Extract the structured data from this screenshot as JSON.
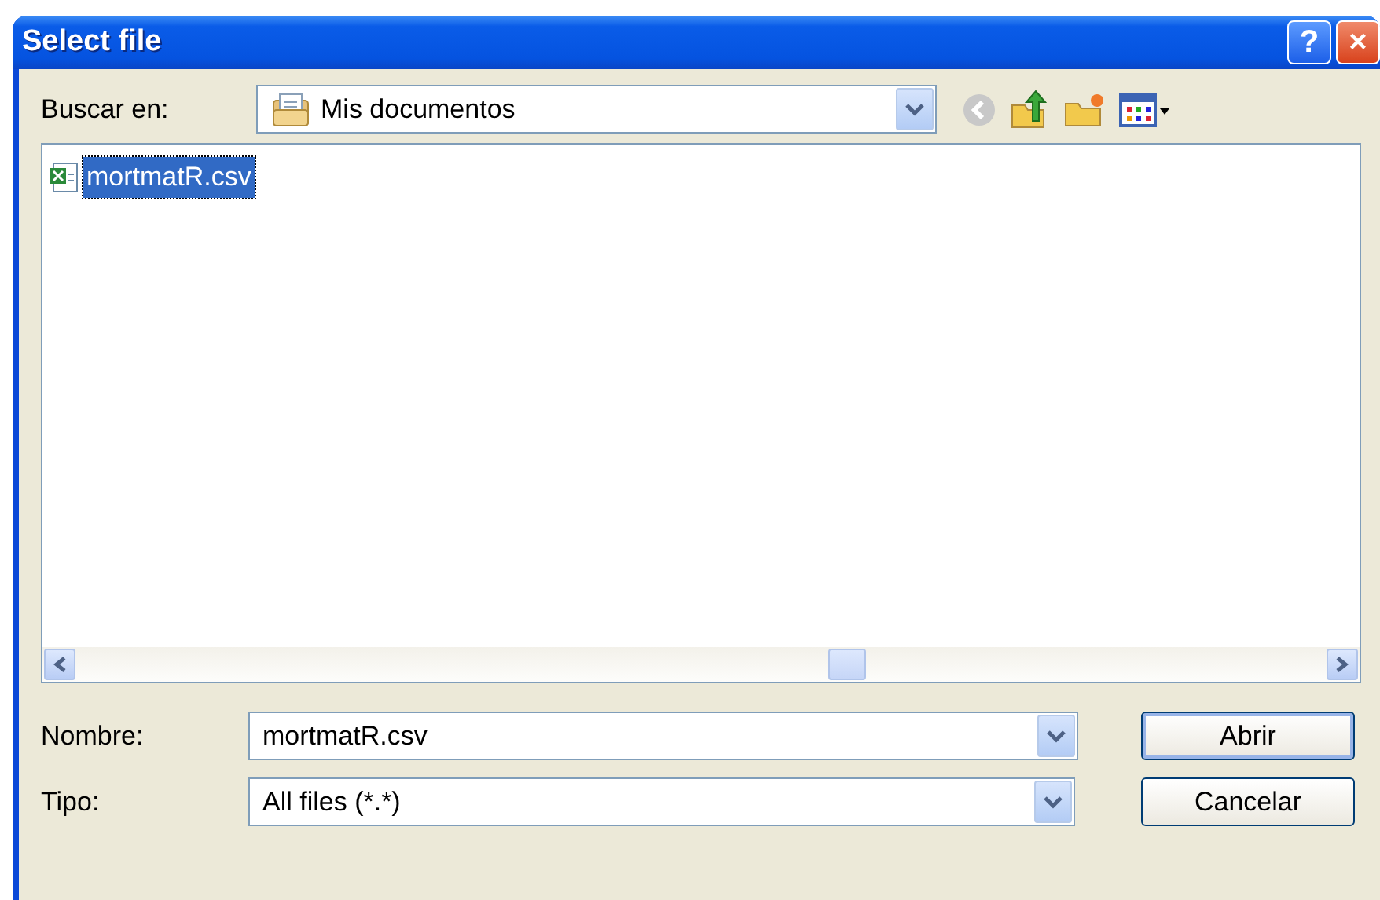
{
  "window": {
    "title": "Select file",
    "title_buttons": [
      "?",
      "×"
    ]
  },
  "look_in": {
    "label": "Buscar en:",
    "value": "Mis documentos"
  },
  "files": [
    {
      "name": "mortmatR.csv",
      "selected": true
    }
  ],
  "file_name": {
    "label": "Nombre:",
    "value": "mortmatR.csv"
  },
  "file_type": {
    "label": "Tipo:",
    "value": "All files (*.*)"
  },
  "buttons": [
    {
      "label": "Abrir",
      "default": true
    },
    {
      "label": "Cancelar",
      "default": false
    }
  ]
}
